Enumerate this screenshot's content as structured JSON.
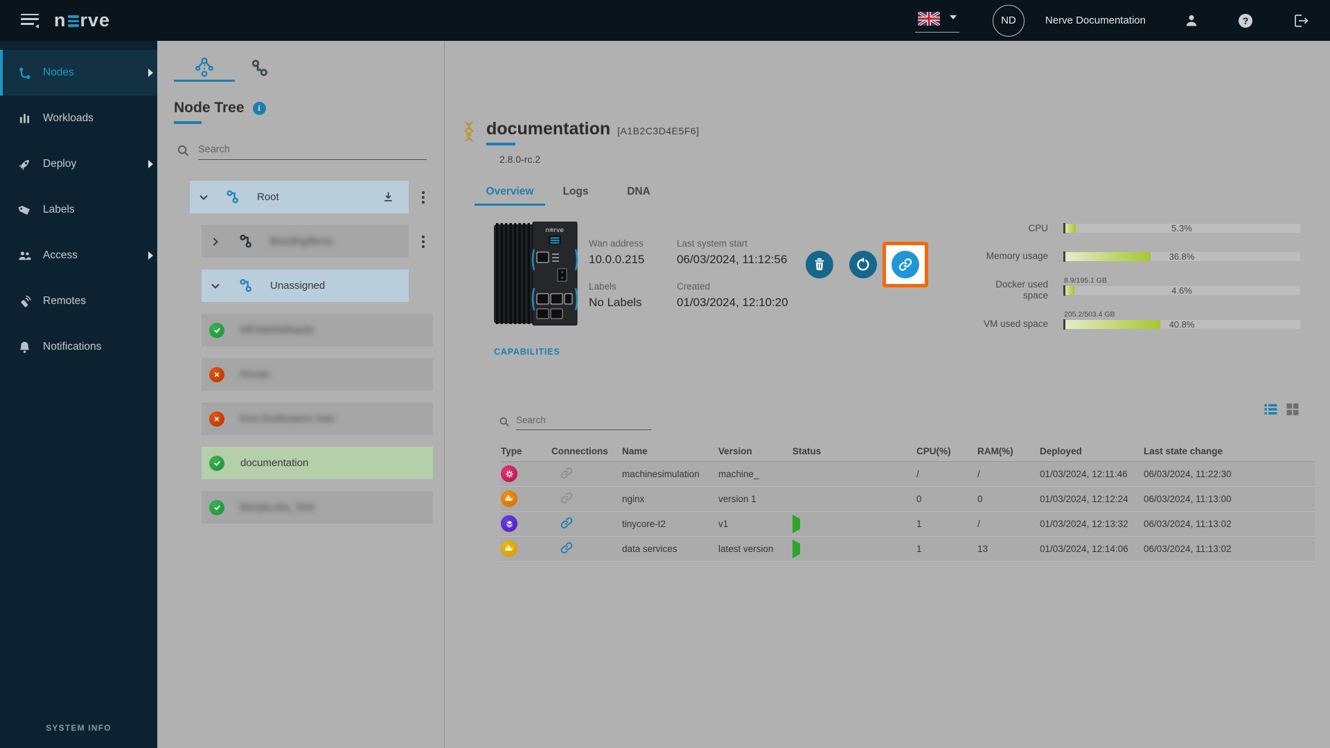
{
  "topbar": {
    "logo_pre": "n",
    "logo_post": "rve",
    "user_initials": "ND",
    "user_name": "Nerve Documentation"
  },
  "sidebar": {
    "items": [
      {
        "label": "Nodes"
      },
      {
        "label": "Workloads"
      },
      {
        "label": "Deploy"
      },
      {
        "label": "Labels"
      },
      {
        "label": "Access"
      },
      {
        "label": "Remotes"
      },
      {
        "label": "Notifications"
      }
    ],
    "system_info": "SYSTEM INFO"
  },
  "tree": {
    "title": "Node Tree",
    "search_placeholder": "Search",
    "items": [
      {
        "label": "Root"
      },
      {
        "label": "Breslingfleros"
      },
      {
        "label": "Unassigned"
      },
      {
        "label": "MFNWIN0hauls"
      },
      {
        "label": "Rsvan"
      },
      {
        "label": "kvm bookwaern ivan"
      },
      {
        "label": "documentation"
      },
      {
        "label": "BanjaLuka_Test"
      }
    ]
  },
  "detail": {
    "name": "documentation",
    "serial": "[A1B2C3D4E5F6]",
    "version": "2.8.0-rc.2",
    "tabs": {
      "overview": "Overview",
      "logs": "Logs",
      "dna": "DNA"
    },
    "fields": {
      "wan_label": "Wan address",
      "wan_value": "10.0.0.215",
      "last_start_label": "Last system start",
      "last_start_value": "06/03/2024, 11:12:56",
      "labels_label": "Labels",
      "labels_value": "No Labels",
      "created_label": "Created",
      "created_value": "01/03/2024, 12:10:20"
    },
    "capabilities_label": "CAPABILITIES",
    "stats": [
      {
        "label": "CPU",
        "sub": "",
        "value": "5.3%",
        "pct": "5.3%"
      },
      {
        "label": "Memory usage",
        "sub": "",
        "value": "36.8%",
        "pct": "36.8%"
      },
      {
        "label": "Docker used space",
        "sub": "8.9/195.1 GB",
        "value": "4.6%",
        "pct": "4.6%"
      },
      {
        "label": "VM used space",
        "sub": "205.2/503.4 GB",
        "value": "40.8%",
        "pct": "40.8%"
      }
    ]
  },
  "workloads": {
    "search_placeholder": "Search",
    "columns": [
      "Type",
      "Connections",
      "Name",
      "Version",
      "Status",
      "CPU(%)",
      "RAM(%)",
      "Deployed",
      "Last state change"
    ],
    "rows": [
      {
        "name": "machinesimulation",
        "version": "machine_",
        "cpu": "/",
        "ram": "/",
        "deployed": "01/03/2024, 12:11:46",
        "last_state": "06/03/2024, 11:22:30"
      },
      {
        "name": "nginx",
        "version": "version 1",
        "cpu": "0",
        "ram": "0",
        "deployed": "01/03/2024, 12:12:24",
        "last_state": "06/03/2024, 11:13:00"
      },
      {
        "name": "tinycore-t2",
        "version": "v1",
        "cpu": "1",
        "ram": "/",
        "deployed": "01/03/2024, 12:13:32",
        "last_state": "06/03/2024, 11:13:02"
      },
      {
        "name": "data services",
        "version": "latest version",
        "cpu": "1",
        "ram": "13",
        "deployed": "01/03/2024, 12:14:06",
        "last_state": "06/03/2024, 11:13:02"
      }
    ]
  },
  "colors": {
    "accent_blue": "#1b7fae",
    "highlight_orange": "#f2690d",
    "bar_green": "#a6c72e",
    "status_running": "#2ca52c",
    "status_stopped": "#c01818",
    "node_online": "#2aa347",
    "node_offline": "#c94208",
    "button_teal": "#15678b",
    "button_blue": "#2196d4"
  }
}
